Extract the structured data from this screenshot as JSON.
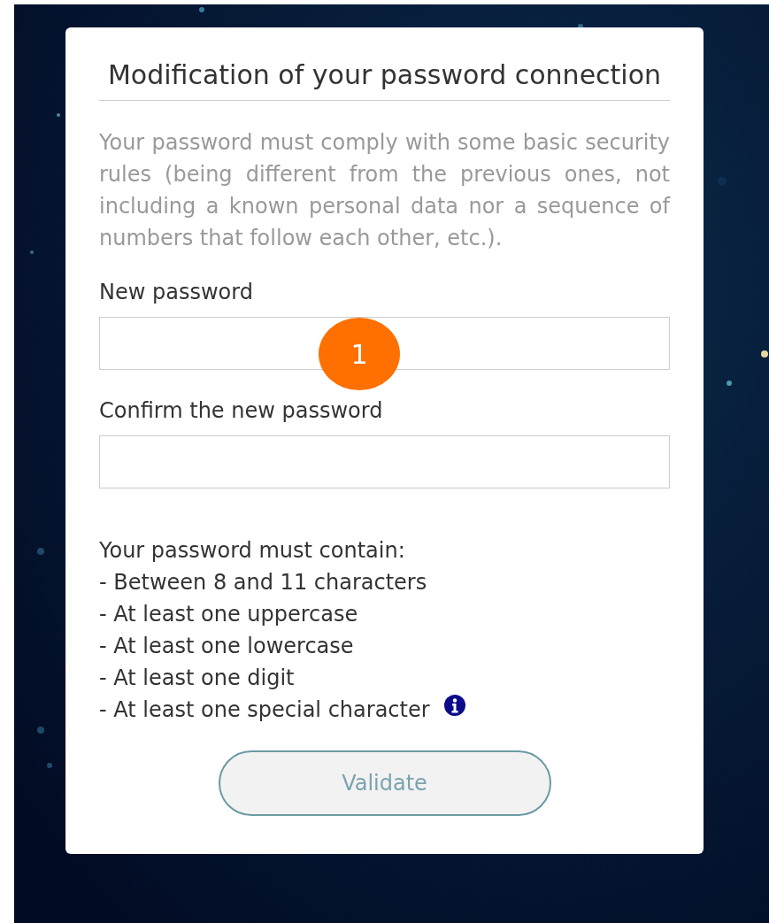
{
  "dialog": {
    "title": "Modification of your password connection",
    "intro": "Your password must comply with some basic security rules (being different from the previous ones, not including a known personal data nor a sequence of numbers that follow each other, etc.).",
    "fields": [
      {
        "label": "New password"
      },
      {
        "label": "Confirm the new password"
      }
    ],
    "requirements_title": "Your password must contain:",
    "requirements": [
      {
        "text": "- Between 8 and 11 characters",
        "info": false
      },
      {
        "text": "- At least one uppercase",
        "info": false
      },
      {
        "text": "- At least one lowercase",
        "info": false
      },
      {
        "text": "- At least one digit",
        "info": false
      },
      {
        "text": "- At least one special character",
        "info": true
      }
    ],
    "button": {
      "label": "Validate",
      "disabled": true
    }
  },
  "annotation_badge": "1"
}
